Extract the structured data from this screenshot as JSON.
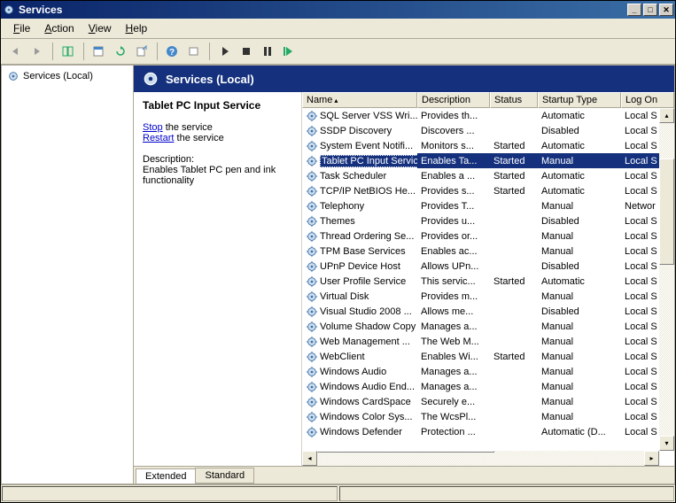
{
  "window": {
    "title": "Services"
  },
  "menu": {
    "file": "File",
    "action": "Action",
    "view": "View",
    "help": "Help"
  },
  "tree": {
    "root": "Services (Local)"
  },
  "header": {
    "title": "Services (Local)"
  },
  "detail": {
    "service_name": "Tablet PC Input Service",
    "stop_pre": "Stop",
    "stop_post": " the service",
    "restart_pre": "Restart",
    "restart_post": " the service",
    "desc_label": "Description:",
    "desc": "Enables Tablet PC pen and ink functionality"
  },
  "columns": {
    "name": "Name",
    "description": "Description",
    "status": "Status",
    "startup": "Startup Type",
    "logon": "Log On"
  },
  "services": [
    {
      "name": "SQL Server VSS Wri...",
      "desc": "Provides th...",
      "status": "",
      "startup": "Automatic",
      "logon": "Local S"
    },
    {
      "name": "SSDP Discovery",
      "desc": "Discovers ...",
      "status": "",
      "startup": "Disabled",
      "logon": "Local S"
    },
    {
      "name": "System Event Notifi...",
      "desc": "Monitors s...",
      "status": "Started",
      "startup": "Automatic",
      "logon": "Local S"
    },
    {
      "name": "Tablet PC Input Service",
      "desc": "Enables Ta...",
      "status": "Started",
      "startup": "Manual",
      "logon": "Local S",
      "selected": true
    },
    {
      "name": "Task Scheduler",
      "desc": "Enables a ...",
      "status": "Started",
      "startup": "Automatic",
      "logon": "Local S"
    },
    {
      "name": "TCP/IP NetBIOS He...",
      "desc": "Provides s...",
      "status": "Started",
      "startup": "Automatic",
      "logon": "Local S"
    },
    {
      "name": "Telephony",
      "desc": "Provides T...",
      "status": "",
      "startup": "Manual",
      "logon": "Networ"
    },
    {
      "name": "Themes",
      "desc": "Provides u...",
      "status": "",
      "startup": "Disabled",
      "logon": "Local S"
    },
    {
      "name": "Thread Ordering Se...",
      "desc": "Provides or...",
      "status": "",
      "startup": "Manual",
      "logon": "Local S"
    },
    {
      "name": "TPM Base Services",
      "desc": "Enables ac...",
      "status": "",
      "startup": "Manual",
      "logon": "Local S"
    },
    {
      "name": "UPnP Device Host",
      "desc": "Allows UPn...",
      "status": "",
      "startup": "Disabled",
      "logon": "Local S"
    },
    {
      "name": "User Profile Service",
      "desc": "This servic...",
      "status": "Started",
      "startup": "Automatic",
      "logon": "Local S"
    },
    {
      "name": "Virtual Disk",
      "desc": "Provides m...",
      "status": "",
      "startup": "Manual",
      "logon": "Local S"
    },
    {
      "name": "Visual Studio 2008 ...",
      "desc": "Allows me...",
      "status": "",
      "startup": "Disabled",
      "logon": "Local S"
    },
    {
      "name": "Volume Shadow Copy",
      "desc": "Manages a...",
      "status": "",
      "startup": "Manual",
      "logon": "Local S"
    },
    {
      "name": "Web Management ...",
      "desc": "The Web M...",
      "status": "",
      "startup": "Manual",
      "logon": "Local S"
    },
    {
      "name": "WebClient",
      "desc": "Enables Wi...",
      "status": "Started",
      "startup": "Manual",
      "logon": "Local S"
    },
    {
      "name": "Windows Audio",
      "desc": "Manages a...",
      "status": "",
      "startup": "Manual",
      "logon": "Local S"
    },
    {
      "name": "Windows Audio End...",
      "desc": "Manages a...",
      "status": "",
      "startup": "Manual",
      "logon": "Local S"
    },
    {
      "name": "Windows CardSpace",
      "desc": "Securely e...",
      "status": "",
      "startup": "Manual",
      "logon": "Local S"
    },
    {
      "name": "Windows Color Sys...",
      "desc": "The WcsPl...",
      "status": "",
      "startup": "Manual",
      "logon": "Local S"
    },
    {
      "name": "Windows Defender",
      "desc": "Protection ...",
      "status": "",
      "startup": "Automatic (D...",
      "logon": "Local S"
    }
  ],
  "tabs": {
    "extended": "Extended",
    "standard": "Standard"
  }
}
